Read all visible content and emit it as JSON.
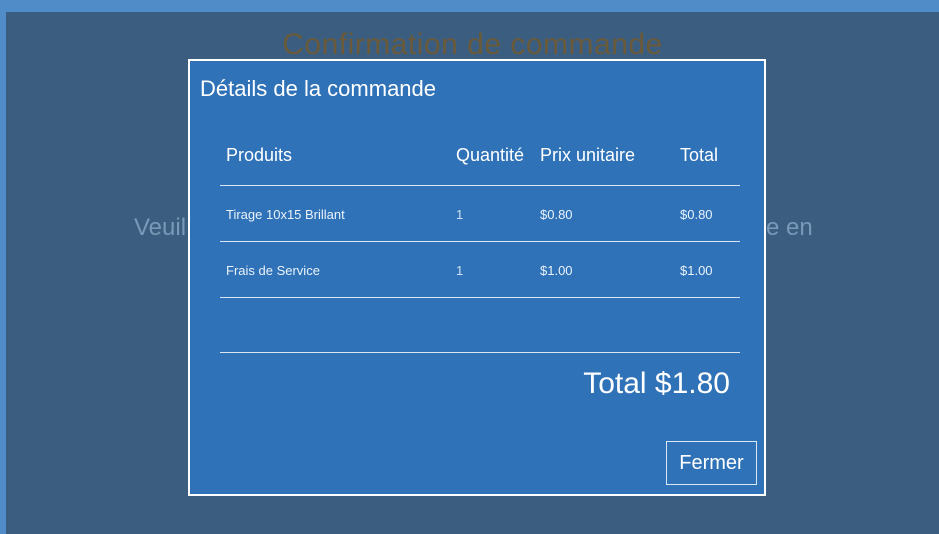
{
  "background": {
    "title": "Confirmation de commande",
    "text_left": "Veuil",
    "text_right": "re en"
  },
  "modal": {
    "title": "Détails de la commande",
    "columns": [
      "Produits",
      "Quantité",
      "Prix unitaire",
      "Total"
    ],
    "rows": [
      {
        "product": "Tirage 10x15 Brillant",
        "quantity": "1",
        "unit_price": "$0.80",
        "total": "$0.80"
      },
      {
        "product": "Frais de Service",
        "quantity": "1",
        "unit_price": "$1.00",
        "total": "$1.00"
      }
    ],
    "total_label": "Total $1.80",
    "close_label": "Fermer"
  },
  "colors": {
    "accent": "#2f72b7",
    "backdrop": "#3b5e80",
    "outer": "#4f8cc8"
  }
}
